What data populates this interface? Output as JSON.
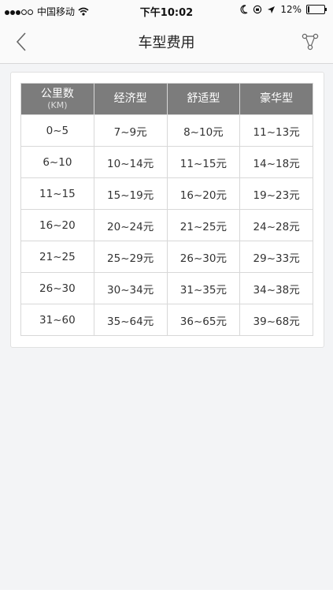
{
  "status_bar": {
    "carrier": "中国移动",
    "time": "下午10:02",
    "battery": "12%",
    "battery_level": 0.12
  },
  "header": {
    "title": "车型费用",
    "back_icon": "chevron-left-icon",
    "share_icon": "share-icon"
  },
  "table": {
    "headers": [
      {
        "main": "公里数",
        "sub": "(KM)"
      },
      {
        "main": "经济型",
        "sub": ""
      },
      {
        "main": "舒适型",
        "sub": ""
      },
      {
        "main": "豪华型",
        "sub": ""
      }
    ],
    "rows": [
      [
        "0~5",
        "7~9元",
        "8~10元",
        "11~13元"
      ],
      [
        "6~10",
        "10~14元",
        "11~15元",
        "14~18元"
      ],
      [
        "11~15",
        "15~19元",
        "16~20元",
        "19~23元"
      ],
      [
        "16~20",
        "20~24元",
        "21~25元",
        "24~28元"
      ],
      [
        "21~25",
        "25~29元",
        "26~30元",
        "29~33元"
      ],
      [
        "26~30",
        "30~34元",
        "31~35元",
        "34~38元"
      ],
      [
        "31~60",
        "35~64元",
        "36~65元",
        "39~68元"
      ]
    ]
  },
  "colors": {
    "header_bg": "#7c7c7c",
    "page_bg": "#f3f4f6"
  }
}
